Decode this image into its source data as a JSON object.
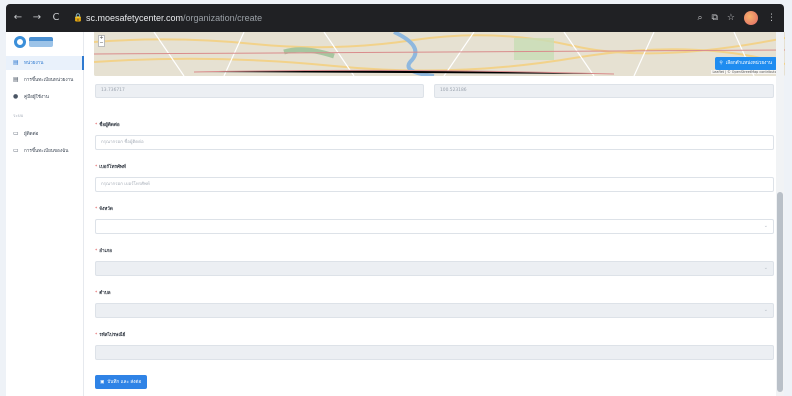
{
  "browser": {
    "url_host": "sc.moesafetycenter.com",
    "url_path": "/organization/create",
    "back_icon": "arrow-left-icon",
    "forward_icon": "arrow-right-icon",
    "reload_icon": "reload-icon"
  },
  "sidebar": {
    "items": [
      {
        "label": "หน่วยงาน",
        "icon": "building-icon"
      },
      {
        "label": "การขึ้นทะเบียนหน่วยงาน",
        "icon": "register-icon"
      },
      {
        "label": "คู่มือผู้ใช้งาน",
        "icon": "book-icon"
      }
    ],
    "section_label": "ระบบ",
    "sub_items": [
      {
        "label": "ผู้ติดต่อ",
        "icon": "contact-icon"
      },
      {
        "label": "การขึ้นทะเบียนของฉัน",
        "icon": "list-icon"
      }
    ]
  },
  "map": {
    "pick_location_label": "เลือกตำแหน่งหน่วยงาน",
    "attribution": "Leaflet | © OpenStreetMap contributors",
    "zoom_in": "+",
    "zoom_out": "−"
  },
  "coords": {
    "latitude": "13.736717",
    "longitude": "100.523186"
  },
  "form": {
    "fields": [
      {
        "label": "ชื่อผู้ติดต่อ",
        "placeholder": "กรุณากรอก ชื่อผู้ติดต่อ",
        "type": "text",
        "disabled": false
      },
      {
        "label": "เบอร์โทรศัพท์",
        "placeholder": "กรุณากรอก เบอร์โทรศัพท์",
        "type": "text",
        "disabled": false
      },
      {
        "label": "จังหวัด",
        "placeholder": "",
        "type": "select",
        "disabled": false
      },
      {
        "label": "อำเภอ",
        "placeholder": "",
        "type": "select",
        "disabled": true
      },
      {
        "label": "ตำบล",
        "placeholder": "",
        "type": "select",
        "disabled": true
      },
      {
        "label": "รหัสไปรษณีย์",
        "placeholder": "",
        "type": "text",
        "disabled": true
      }
    ],
    "required_mark": "*",
    "save_label": "บันทึก และ ส่งต่อ"
  },
  "colors": {
    "accent": "#2f83e6",
    "map_button": "#1f8cf0",
    "required": "#e05252"
  }
}
